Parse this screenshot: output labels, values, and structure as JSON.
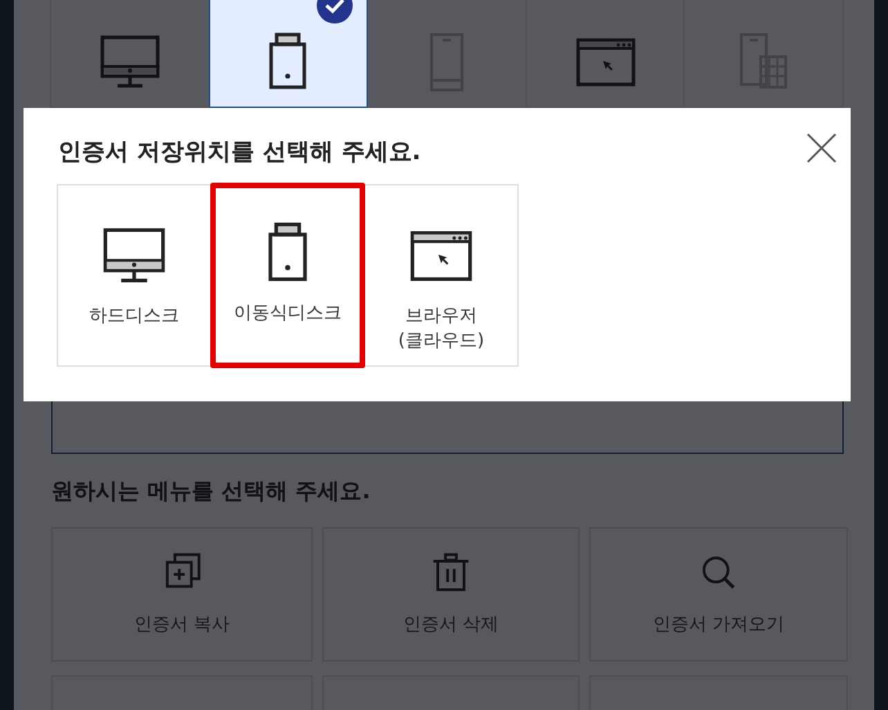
{
  "storage_tiles": [
    {
      "kind": "monitor",
      "selected": false,
      "disabled": false
    },
    {
      "kind": "usb",
      "selected": true,
      "disabled": false
    },
    {
      "kind": "phone",
      "selected": false,
      "disabled": true
    },
    {
      "kind": "browser",
      "selected": false,
      "disabled": false
    },
    {
      "kind": "phone-table",
      "selected": false,
      "disabled": true
    }
  ],
  "menu": {
    "heading": "원하시는 메뉴를 선택해 주세요.",
    "items": [
      {
        "kind": "copy",
        "label": "인증서 복사"
      },
      {
        "kind": "trash",
        "label": "인증서 삭제"
      },
      {
        "kind": "search",
        "label": "인증서 가져오기"
      }
    ]
  },
  "dialog": {
    "title": "인증서 저장위치를 선택해 주세요.",
    "options": [
      {
        "kind": "monitor",
        "label": "하드디스크",
        "selected": false
      },
      {
        "kind": "usb",
        "label": "이동식디스크",
        "selected": true
      },
      {
        "kind": "browser",
        "label": "브라우저\n(클라우드)",
        "selected": false
      }
    ]
  }
}
